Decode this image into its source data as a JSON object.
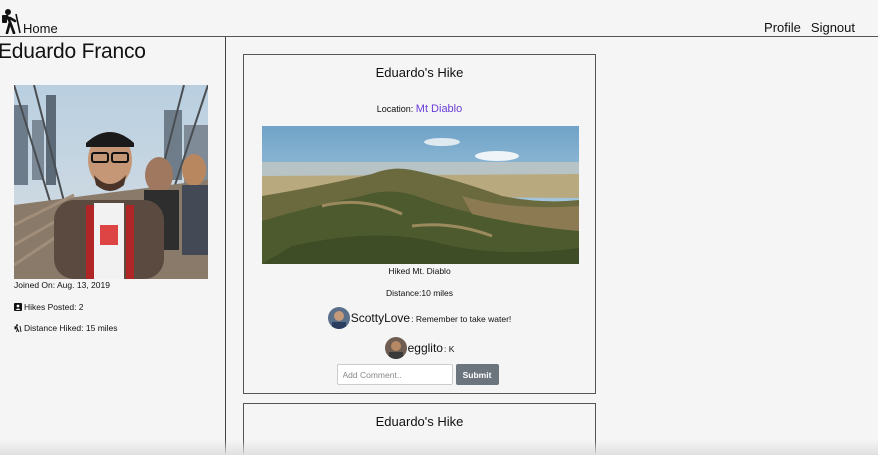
{
  "nav": {
    "home_label": "Home",
    "profile_label": "Profile",
    "signout_label": "Signout"
  },
  "profile": {
    "name": "Eduardo Franco",
    "joined": "Joined On: Aug. 13, 2019",
    "hikes_posted": "Hikes Posted: 2",
    "distance_hiked": "Distance Hiked: 15 miles"
  },
  "posts": [
    {
      "title": "Eduardo's Hike",
      "location_label": "Location:",
      "location_value": "Mt Diablo",
      "caption": "Hiked Mt. Diablo",
      "distance": "Distance:10 miles",
      "comments": [
        {
          "user": "ScottyLove",
          "text": ": Remember to take water!"
        },
        {
          "user": "egglito",
          "text": ": K"
        }
      ],
      "comment_placeholder": "Add Comment..",
      "submit_label": "Submit"
    },
    {
      "title": "Eduardo's Hike"
    }
  ],
  "colors": {
    "background": "#f5f5f5",
    "location_link": "#6a3fd8",
    "submit_button": "#6c757d"
  },
  "icons": [
    "hiker-icon",
    "user-card-icon",
    "hiker-small-icon"
  ]
}
